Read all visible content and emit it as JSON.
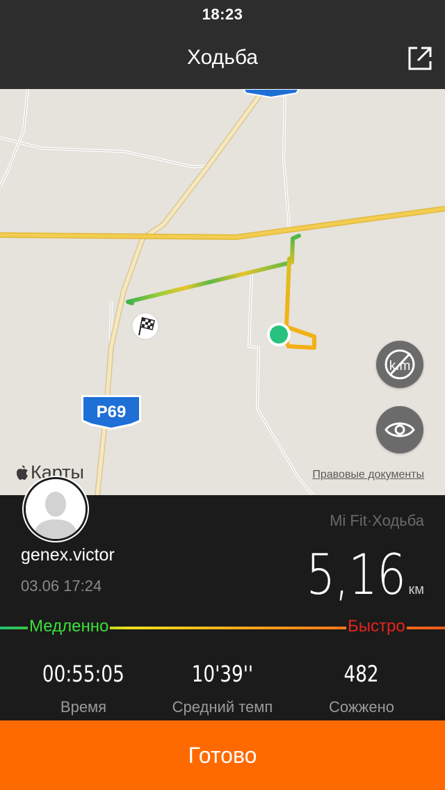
{
  "status_bar": {
    "time": "18:23"
  },
  "nav": {
    "title": "Ходьба",
    "share_icon": "share-icon"
  },
  "map": {
    "route_sign": "P69",
    "brand": "Карты",
    "legal_link": "Правовые документы",
    "buttons": {
      "units_icon": "km-off-icon",
      "visibility_icon": "eye-icon"
    },
    "start_marker_icon": "start-dot-icon",
    "finish_marker_icon": "checkered-flag-icon"
  },
  "user": {
    "name": "genex.victor",
    "datetime": "03.06 17:24"
  },
  "activity": {
    "source": "Mi Fit·Ходьба",
    "distance": "5,16",
    "distance_unit": "км"
  },
  "pace_scale": {
    "slow_label": "Медленно",
    "fast_label": "Быстро"
  },
  "stats": [
    {
      "value": "00:55:05",
      "label": "Время"
    },
    {
      "value": "10'39''",
      "label": "Средний темп"
    },
    {
      "value": "482",
      "label": "Сожжено"
    }
  ],
  "actions": {
    "done_label": "Готово"
  },
  "colors": {
    "accent": "#ff6a00",
    "header": "#2d2d2d",
    "panel": "#1b1b1b",
    "slow": "#3be03a",
    "fast": "#e8231b",
    "map_bg": "#e6e2dc",
    "road": "#efc94c"
  }
}
